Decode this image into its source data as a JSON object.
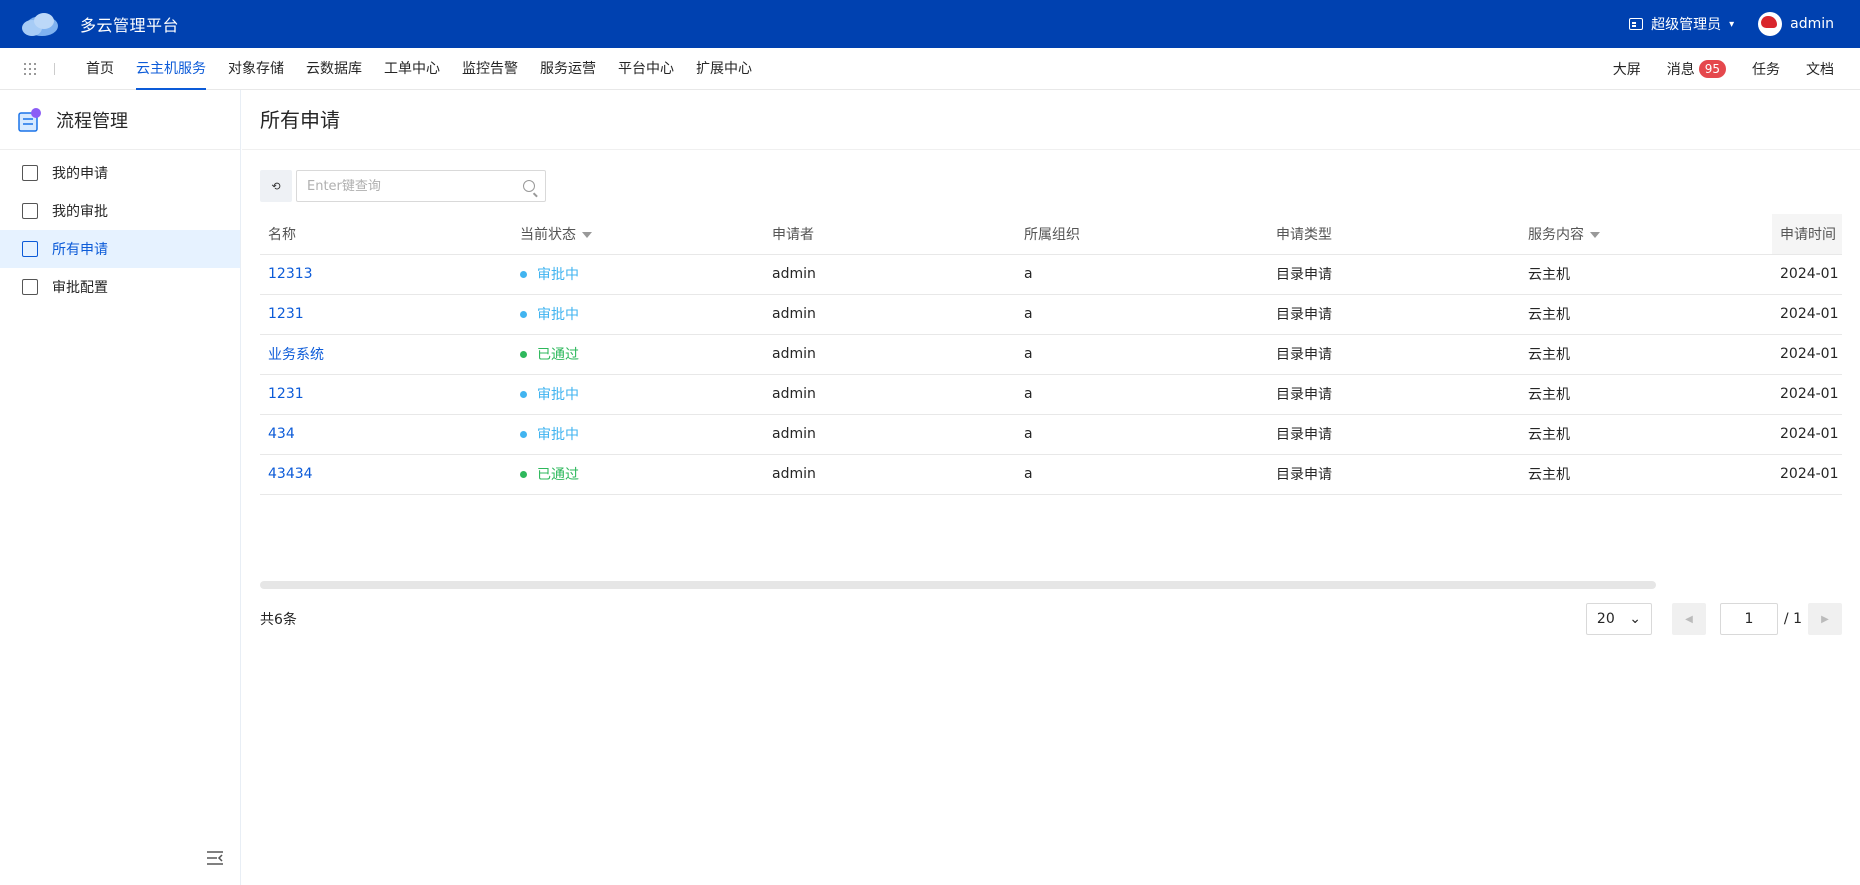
{
  "app": {
    "title": "多云管理平台"
  },
  "topbar": {
    "role": "超级管理员",
    "user": "admin",
    "logo_icon": "cloud-icon"
  },
  "nav": {
    "items": [
      "首页",
      "云主机服务",
      "对象存储",
      "云数据库",
      "工单中心",
      "监控告警",
      "服务运营",
      "平台中心",
      "扩展中心"
    ],
    "active_index": 1,
    "right": {
      "screen": "大屏",
      "messages": "消息",
      "message_count": "95",
      "tasks": "任务",
      "docs": "文档"
    }
  },
  "sidebar": {
    "title": "流程管理",
    "items": [
      {
        "label": "我的申请",
        "icon": "upload-doc-icon"
      },
      {
        "label": "我的审批",
        "icon": "stamp-icon"
      },
      {
        "label": "所有申请",
        "icon": "list-doc-icon",
        "active": true
      },
      {
        "label": "审批配置",
        "icon": "settings-list-icon"
      }
    ]
  },
  "main": {
    "title": "所有申请",
    "refresh_glyph": "⟲",
    "search": {
      "placeholder": "Enter键查询",
      "value": ""
    },
    "columns": [
      "名称",
      "当前状态",
      "申请者",
      "所属组织",
      "申请类型",
      "服务内容",
      "申请时间"
    ],
    "rows": [
      {
        "name": "12313",
        "status": "审批中",
        "status_color": "#41b4f0",
        "applicant": "admin",
        "org": "a",
        "type": "目录申请",
        "service": "云主机",
        "time": "2024-01"
      },
      {
        "name": "1231",
        "status": "审批中",
        "status_color": "#41b4f0",
        "applicant": "admin",
        "org": "a",
        "type": "目录申请",
        "service": "云主机",
        "time": "2024-01"
      },
      {
        "name": "业务系统",
        "status": "已通过",
        "status_color": "#2eb85c",
        "applicant": "admin",
        "org": "a",
        "type": "目录申请",
        "service": "云主机",
        "time": "2024-01"
      },
      {
        "name": "1231",
        "status": "审批中",
        "status_color": "#41b4f0",
        "applicant": "admin",
        "org": "a",
        "type": "目录申请",
        "service": "云主机",
        "time": "2024-01"
      },
      {
        "name": "434",
        "status": "审批中",
        "status_color": "#41b4f0",
        "applicant": "admin",
        "org": "a",
        "type": "目录申请",
        "service": "云主机",
        "time": "2024-01"
      },
      {
        "name": "43434",
        "status": "已通过",
        "status_color": "#2eb85c",
        "applicant": "admin",
        "org": "a",
        "type": "目录申请",
        "service": "云主机",
        "time": "2024-01"
      }
    ],
    "footer": {
      "total": "共6条",
      "page_size": "20",
      "current_page": "1",
      "total_pages": "/ 1"
    }
  }
}
